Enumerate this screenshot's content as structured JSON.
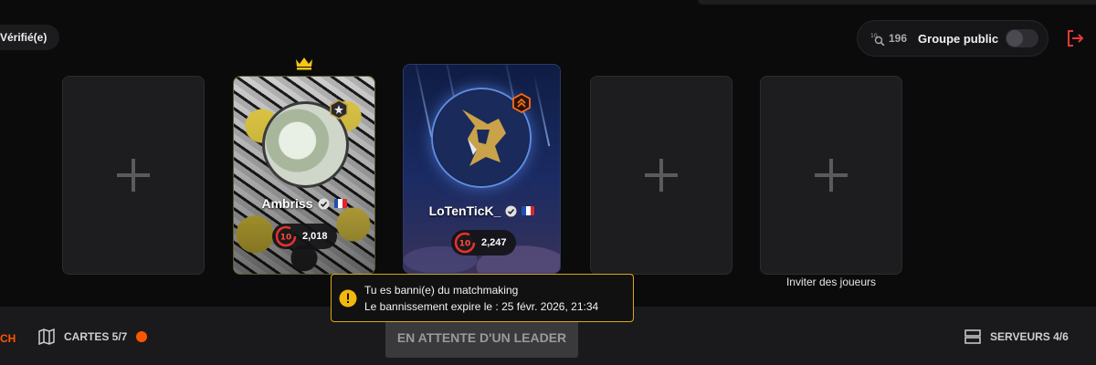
{
  "header": {
    "verified_label": "Vérifié(e)",
    "elo_icon": "elo-search-icon",
    "group_count": "196",
    "group_label": "Groupe public",
    "group_public_on": false,
    "leave_icon": "exit-icon"
  },
  "party": {
    "leader_icon": "crown-icon",
    "players": [
      {
        "name": "Ambriss",
        "verified": true,
        "country": "france-flag",
        "level": "10",
        "elo": "2,018",
        "rank_badge": "star-rank-badge-icon"
      },
      {
        "name": "LoTenTicK_",
        "verified": true,
        "country": "france-flag",
        "level": "10",
        "elo": "2,247",
        "rank_badge": "chevron-rank-badge-icon"
      }
    ],
    "invite_label": "Inviter des joueurs"
  },
  "notification": {
    "line1": "Tu es banni(e) du matchmaking",
    "line2": "Le bannissement expire le : 25 févr. 2026, 21:34",
    "icon": "warning-icon"
  },
  "bottom_bar": {
    "start_fragment": "CH",
    "maps_label": "CARTES 5/7",
    "wait_label": "EN ATTENTE D'UN LEADER",
    "servers_label": "SERVEURS 4/6"
  },
  "colors": {
    "accent": "#ff5500",
    "warning": "#f0b90b",
    "level_ring": "#e8322c",
    "leave": "#e53935"
  }
}
